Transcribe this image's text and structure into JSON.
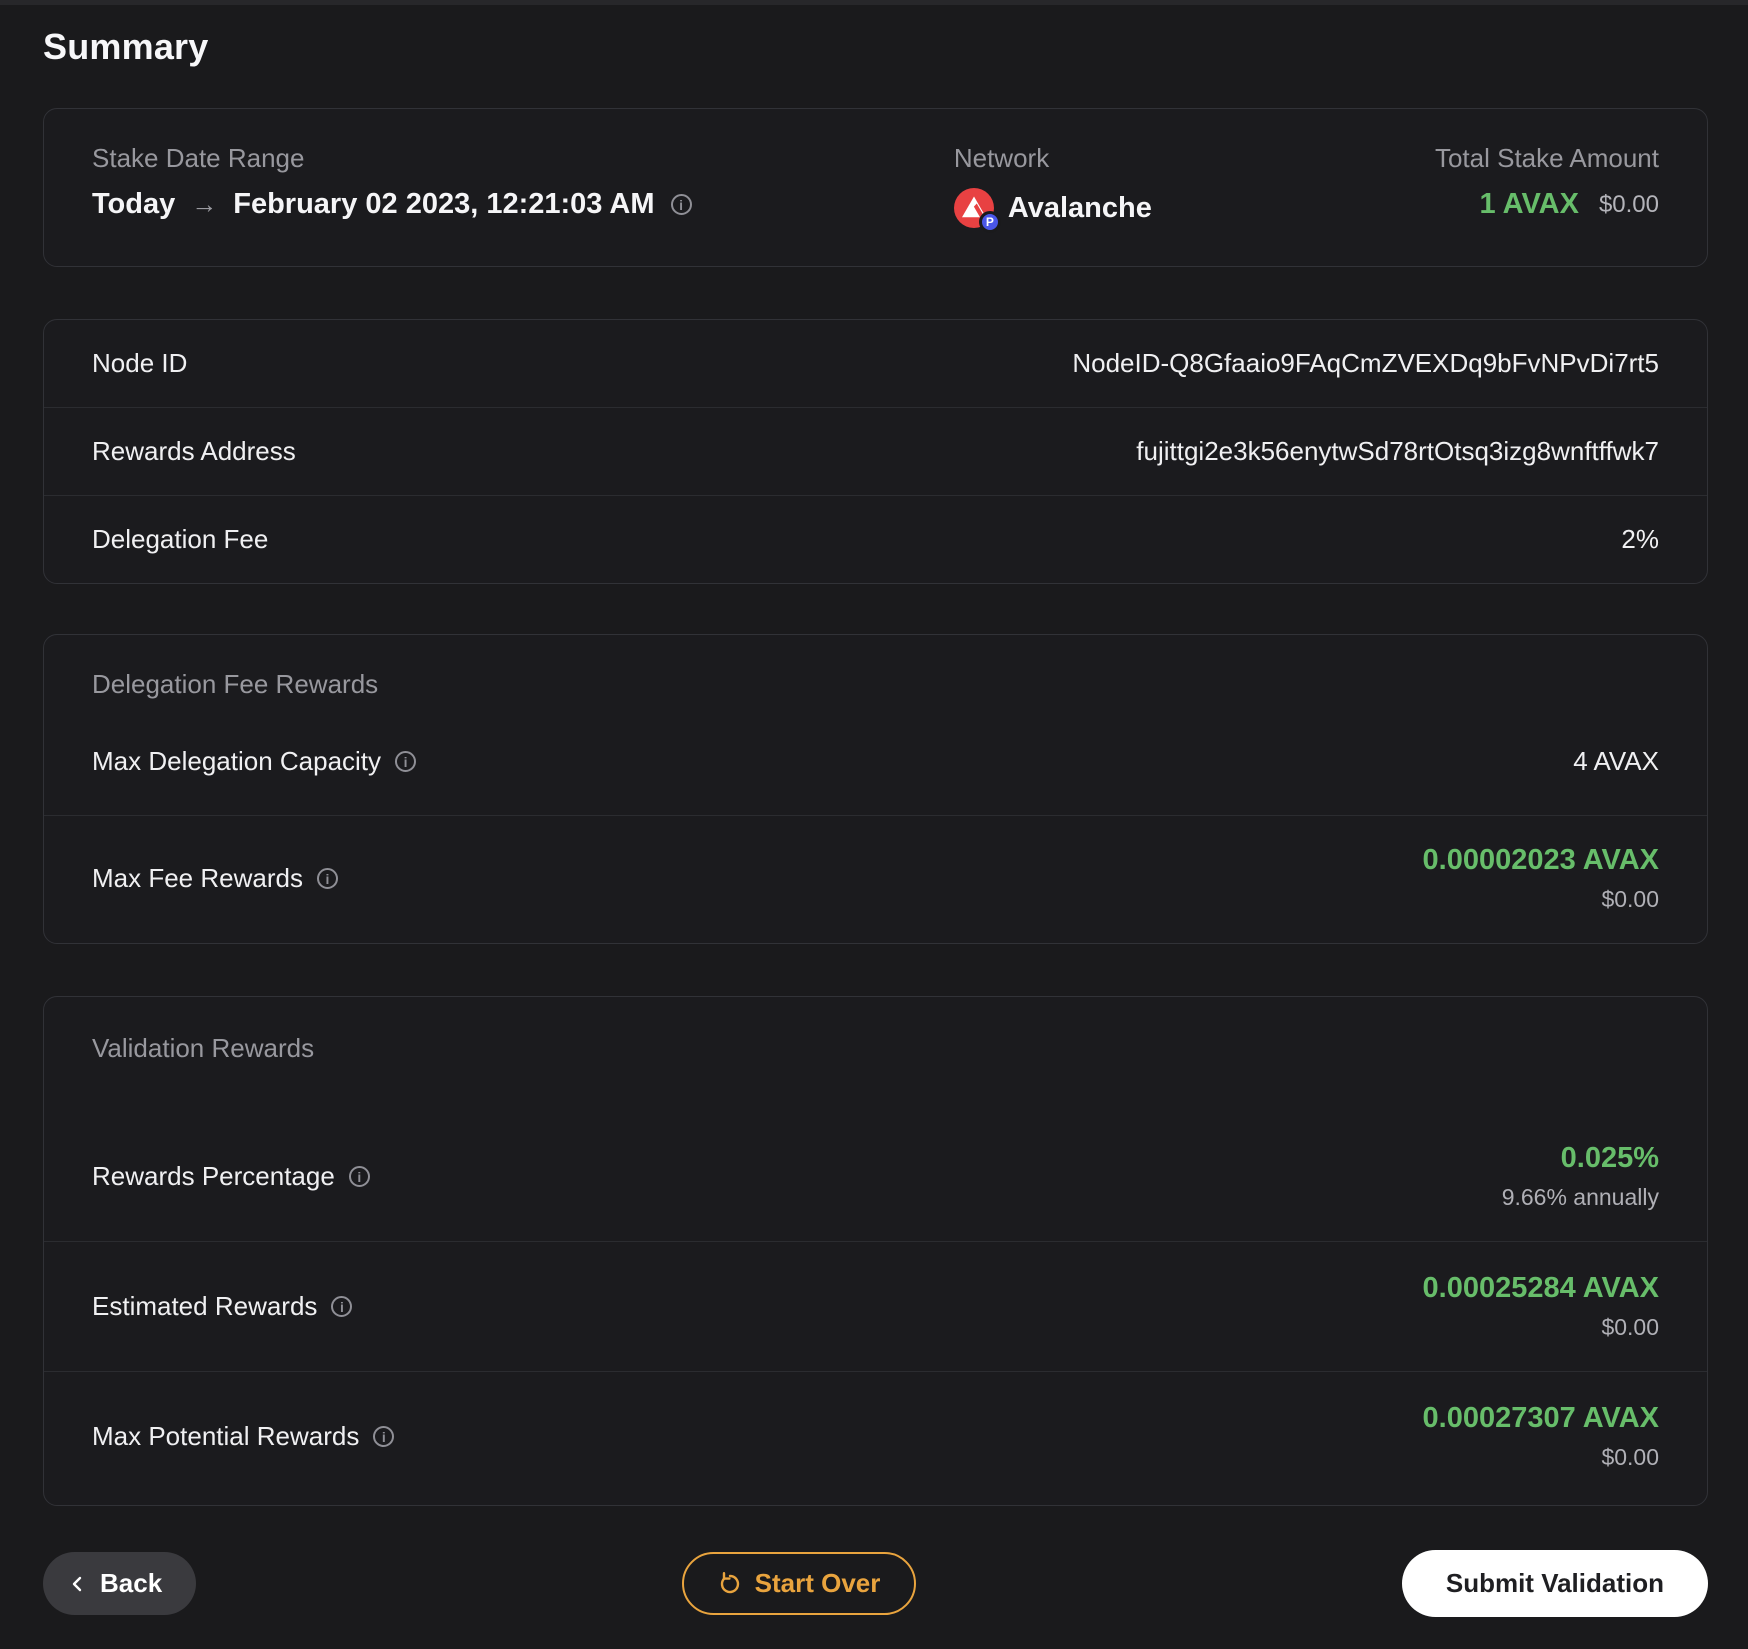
{
  "page": {
    "title": "Summary"
  },
  "icons": {
    "arrow_right": "→",
    "info": "i",
    "p_chain_badge": "P"
  },
  "colors": {
    "accent_green": "#67bd6a",
    "accent_orange": "#e9a43e",
    "avalanche_red": "#e84142",
    "p_chain_blue": "#4a56e8",
    "background": "#1a1a1c"
  },
  "overview": {
    "date_range": {
      "label": "Stake Date Range",
      "from": "Today",
      "to": "February 02 2023, 12:21:03 AM"
    },
    "network": {
      "label": "Network",
      "name": "Avalanche"
    },
    "total_stake": {
      "label": "Total Stake Amount",
      "amount": "1 AVAX",
      "usd": "$0.00"
    }
  },
  "node_details": {
    "node_id": {
      "label": "Node ID",
      "value": "NodeID-Q8Gfaaio9FAqCmZVEXDq9bFvNPvDi7rt5"
    },
    "rewards_address": {
      "label": "Rewards Address",
      "value": "fujittgi2e3k56enytwSd78rtOtsq3izg8wnftffwk7"
    },
    "delegation_fee": {
      "label": "Delegation Fee",
      "value": "2%"
    }
  },
  "delegation_fee_rewards": {
    "header": "Delegation Fee Rewards",
    "max_delegation_capacity": {
      "label": "Max Delegation Capacity",
      "value": "4 AVAX"
    },
    "max_fee_rewards": {
      "label": "Max Fee Rewards",
      "value": "0.00002023 AVAX",
      "usd": "$0.00"
    }
  },
  "validation_rewards": {
    "header": "Validation Rewards",
    "rewards_percentage": {
      "label": "Rewards Percentage",
      "value": "0.025%",
      "sub": "9.66% annually"
    },
    "estimated_rewards": {
      "label": "Estimated Rewards",
      "value": "0.00025284 AVAX",
      "usd": "$0.00"
    },
    "max_potential_rewards": {
      "label": "Max Potential Rewards",
      "value": "0.00027307 AVAX",
      "usd": "$0.00"
    }
  },
  "footer": {
    "back_label": "Back",
    "start_over_label": "Start Over",
    "submit_label": "Submit Validation"
  }
}
